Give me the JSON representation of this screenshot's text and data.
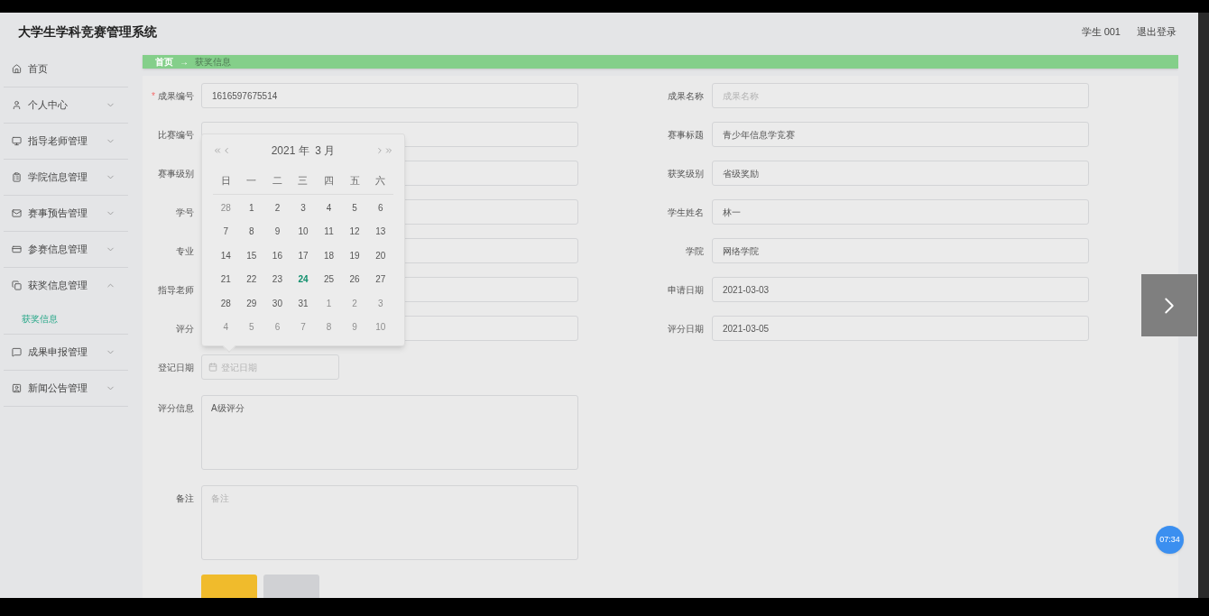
{
  "header": {
    "title": "大学生学科竞赛管理系统",
    "user": "学生 001",
    "logout": "退出登录"
  },
  "sidebar": {
    "items": [
      {
        "label": "首页",
        "kind": "link"
      },
      {
        "label": "个人中心",
        "kind": "menu",
        "expanded": false
      },
      {
        "label": "指导老师管理",
        "kind": "menu",
        "expanded": false
      },
      {
        "label": "学院信息管理",
        "kind": "menu",
        "expanded": false
      },
      {
        "label": "赛事预告管理",
        "kind": "menu",
        "expanded": false
      },
      {
        "label": "参赛信息管理",
        "kind": "menu",
        "expanded": false
      },
      {
        "label": "获奖信息管理",
        "kind": "menu",
        "expanded": true,
        "children": [
          {
            "label": "获奖信息",
            "selected": true
          }
        ]
      },
      {
        "label": "成果申报管理",
        "kind": "menu",
        "expanded": false
      },
      {
        "label": "新闻公告管理",
        "kind": "menu",
        "expanded": false
      }
    ]
  },
  "breadcrumb": {
    "separator": "→",
    "items": [
      {
        "label": "首页",
        "current": false
      },
      {
        "label": "获奖信息",
        "current": true
      }
    ]
  },
  "form": {
    "required_mark": "*",
    "left_fields": [
      {
        "label": "成果编号",
        "required": true,
        "value": "1616597675514"
      },
      {
        "label": "比赛编号",
        "required": false
      },
      {
        "label": "赛事级别",
        "required": false
      },
      {
        "label": "学号",
        "required": false
      },
      {
        "label": "专业",
        "required": false
      },
      {
        "label": "指导老师",
        "required": false
      },
      {
        "label": "评分",
        "required": false
      }
    ],
    "right_fields": [
      {
        "label": "成果名称",
        "placeholder": "成果名称"
      },
      {
        "label": "赛事标题",
        "value": "青少年信息学竞赛"
      },
      {
        "label": "获奖级别",
        "value": "省级奖励"
      },
      {
        "label": "学生姓名",
        "value": "林一"
      },
      {
        "label": "学院",
        "value": "网络学院"
      },
      {
        "label": "申请日期",
        "value": "2021-03-03"
      },
      {
        "label": "评分日期",
        "value": "2021-03-05"
      }
    ],
    "date_field": {
      "label": "登记日期",
      "placeholder": "登记日期"
    },
    "textareas": [
      {
        "label": "评分信息",
        "value": "A级评分"
      },
      {
        "label": "备注",
        "placeholder": "备注"
      }
    ],
    "buttons": [
      {
        "kind": "primary"
      },
      {
        "kind": "secondary"
      }
    ]
  },
  "calendar": {
    "title": "2021 年  3 月",
    "weekdays": [
      "日",
      "一",
      "二",
      "三",
      "四",
      "五",
      "六"
    ],
    "weeks": [
      [
        {
          "day": "28",
          "kind": "other",
          "today": false
        },
        {
          "day": "1",
          "kind": "current",
          "today": false
        },
        {
          "day": "2",
          "kind": "current",
          "today": false
        },
        {
          "day": "3",
          "kind": "current",
          "today": false
        },
        {
          "day": "4",
          "kind": "current",
          "today": false
        },
        {
          "day": "5",
          "kind": "current",
          "today": false
        },
        {
          "day": "6",
          "kind": "current",
          "today": false
        }
      ],
      [
        {
          "day": "7",
          "kind": "current",
          "today": false
        },
        {
          "day": "8",
          "kind": "current",
          "today": false
        },
        {
          "day": "9",
          "kind": "current",
          "today": false
        },
        {
          "day": "10",
          "kind": "current",
          "today": false
        },
        {
          "day": "11",
          "kind": "current",
          "today": false
        },
        {
          "day": "12",
          "kind": "current",
          "today": false
        },
        {
          "day": "13",
          "kind": "current",
          "today": false
        }
      ],
      [
        {
          "day": "14",
          "kind": "current",
          "today": false
        },
        {
          "day": "15",
          "kind": "current",
          "today": false
        },
        {
          "day": "16",
          "kind": "current",
          "today": false
        },
        {
          "day": "17",
          "kind": "current",
          "today": false
        },
        {
          "day": "18",
          "kind": "current",
          "today": false
        },
        {
          "day": "19",
          "kind": "current",
          "today": false
        },
        {
          "day": "20",
          "kind": "current",
          "today": false
        }
      ],
      [
        {
          "day": "21",
          "kind": "current",
          "today": false
        },
        {
          "day": "22",
          "kind": "current",
          "today": false
        },
        {
          "day": "23",
          "kind": "current",
          "today": false
        },
        {
          "day": "24",
          "kind": "current",
          "today": true
        },
        {
          "day": "25",
          "kind": "current",
          "today": false
        },
        {
          "day": "26",
          "kind": "current",
          "today": false
        },
        {
          "day": "27",
          "kind": "current",
          "today": false
        }
      ],
      [
        {
          "day": "28",
          "kind": "current",
          "today": false
        },
        {
          "day": "29",
          "kind": "current",
          "today": false
        },
        {
          "day": "30",
          "kind": "current",
          "today": false
        },
        {
          "day": "31",
          "kind": "current",
          "today": false
        },
        {
          "day": "1",
          "kind": "other",
          "today": false
        },
        {
          "day": "2",
          "kind": "other",
          "today": false
        },
        {
          "day": "3",
          "kind": "other",
          "today": false
        }
      ],
      [
        {
          "day": "4",
          "kind": "other",
          "today": false
        },
        {
          "day": "5",
          "kind": "other",
          "today": false
        },
        {
          "day": "6",
          "kind": "other",
          "today": false
        },
        {
          "day": "7",
          "kind": "other",
          "today": false
        },
        {
          "day": "8",
          "kind": "other",
          "today": false
        },
        {
          "day": "9",
          "kind": "other",
          "today": false
        },
        {
          "day": "10",
          "kind": "other",
          "today": false
        }
      ]
    ]
  },
  "clock_badge": {
    "time": "07:34"
  }
}
